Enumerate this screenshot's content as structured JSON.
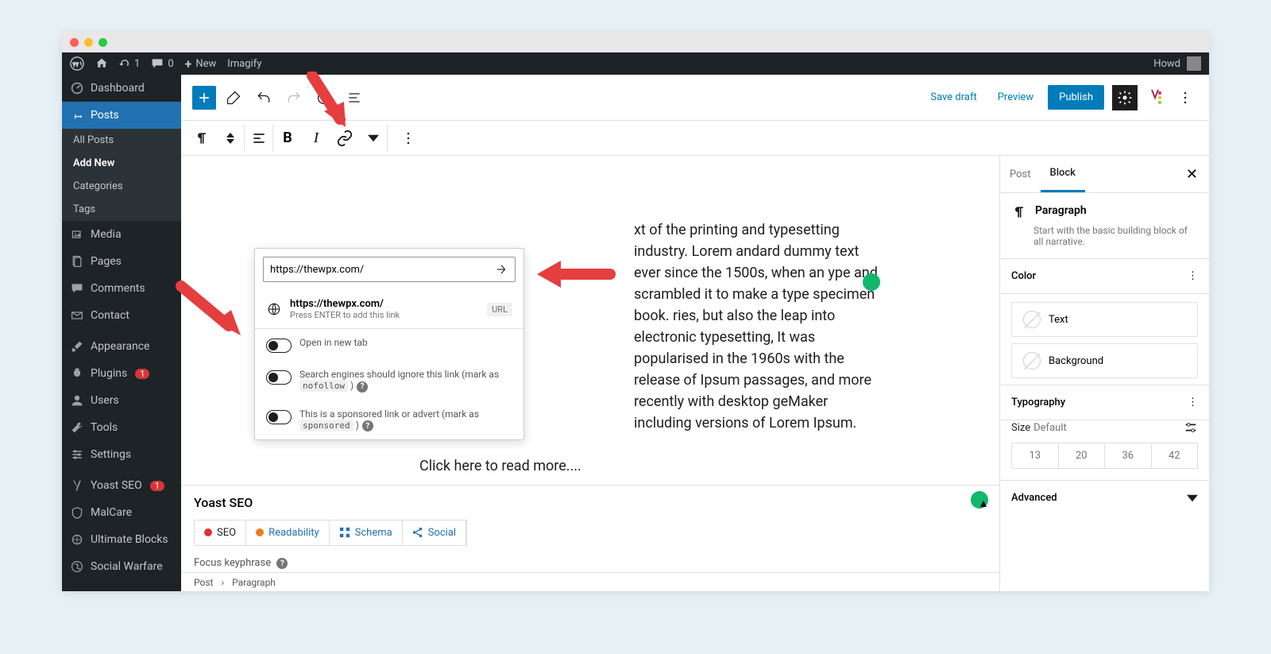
{
  "adminbar": {
    "refresh_count": "1",
    "comments_count": "0",
    "new_label": "New",
    "imagify_label": "Imagify",
    "howdy": "Howd"
  },
  "sidebar": {
    "dashboard": "Dashboard",
    "posts": "Posts",
    "posts_sub": {
      "all": "All Posts",
      "add": "Add New",
      "categories": "Categories",
      "tags": "Tags"
    },
    "media": "Media",
    "pages": "Pages",
    "comments": "Comments",
    "contact": "Contact",
    "appearance": "Appearance",
    "plugins": "Plugins",
    "plugins_badge": "1",
    "users": "Users",
    "tools": "Tools",
    "settings": "Settings",
    "yoast": "Yoast SEO",
    "yoast_badge": "1",
    "malcare": "MalCare",
    "ultimate_blocks": "Ultimate Blocks",
    "social_warfare": "Social Warfare"
  },
  "top_toolbar": {
    "save_draft": "Save draft",
    "preview": "Preview",
    "publish": "Publish"
  },
  "link_popover": {
    "url_value": "https://thewpx.com/",
    "suggestion_title": "https://thewpx.com/",
    "suggestion_sub": "Press ENTER to add this link",
    "url_badge": "URL",
    "opt_new_tab": "Open in new tab",
    "opt_nofollow_pre": "Search engines should ignore this link (mark as ",
    "opt_nofollow_code": "nofollow",
    "opt_nofollow_post": " )",
    "opt_sponsored_pre": "This is a sponsored link or advert (mark as ",
    "opt_sponsored_code": "sponsored",
    "opt_sponsored_post": " )"
  },
  "editor": {
    "paragraph": "xt of the printing and typesetting industry. Lorem andard dummy text ever since the 1500s, when an ype and scrambled it to make a type specimen book. ries, but also the leap into electronic typesetting, It was popularised in the 1960s with the release of Ipsum passages, and more recently with desktop geMaker including versions of Lorem Ipsum.",
    "read_more": "Click here to read more...."
  },
  "right_sidebar": {
    "tab_post": "Post",
    "tab_block": "Block",
    "block_title": "Paragraph",
    "block_desc": "Start with the basic building block of all narrative.",
    "color_title": "Color",
    "color_text": "Text",
    "color_bg": "Background",
    "typography_title": "Typography",
    "size_label": "Size",
    "size_default": "Default",
    "sizes": [
      "13",
      "20",
      "36",
      "42"
    ],
    "advanced_title": "Advanced"
  },
  "yoast_panel": {
    "title": "Yoast SEO",
    "tabs": {
      "seo": "SEO",
      "readability": "Readability",
      "schema": "Schema",
      "social": "Social"
    },
    "focus_keyphrase": "Focus keyphrase"
  },
  "breadcrumb": {
    "post": "Post",
    "paragraph": "Paragraph"
  }
}
